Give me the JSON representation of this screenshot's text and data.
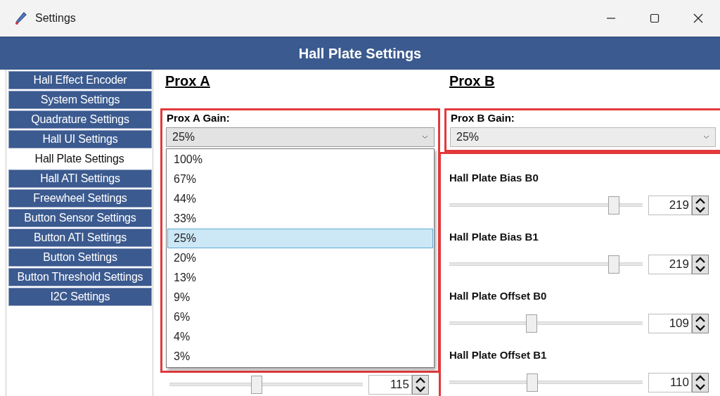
{
  "window": {
    "title": "Settings"
  },
  "header": {
    "title": "Hall Plate Settings"
  },
  "sidebar": {
    "items": [
      {
        "label": "Hall Effect Encoder",
        "selected": false
      },
      {
        "label": "System Settings",
        "selected": false
      },
      {
        "label": "Quadrature Settings",
        "selected": false
      },
      {
        "label": "Hall UI Settings",
        "selected": false
      },
      {
        "label": "Hall Plate Settings",
        "selected": true
      },
      {
        "label": "Hall ATI Settings",
        "selected": false
      },
      {
        "label": "Freewheel Settings",
        "selected": false
      },
      {
        "label": "Button Sensor Settings",
        "selected": false
      },
      {
        "label": "Button ATI Settings",
        "selected": false
      },
      {
        "label": "Button Settings",
        "selected": false
      },
      {
        "label": "Button Threshold Settings",
        "selected": false
      },
      {
        "label": "I2C Settings",
        "selected": false
      }
    ]
  },
  "prox_a": {
    "title": "Prox A",
    "gain": {
      "label": "Prox A Gain:",
      "value": "25%",
      "expanded": true,
      "highlighted": true,
      "options": [
        {
          "label": "100%",
          "selected": false
        },
        {
          "label": "67%",
          "selected": false
        },
        {
          "label": "44%",
          "selected": false
        },
        {
          "label": "33%",
          "selected": false
        },
        {
          "label": "25%",
          "selected": true
        },
        {
          "label": "20%",
          "selected": false
        },
        {
          "label": "13%",
          "selected": false
        },
        {
          "label": "9%",
          "selected": false
        },
        {
          "label": "6%",
          "selected": false
        },
        {
          "label": "4%",
          "selected": false
        },
        {
          "label": "3%",
          "selected": false
        }
      ]
    },
    "sliders": [
      {
        "level": 0.45,
        "value": "115"
      }
    ]
  },
  "prox_b": {
    "title": "Prox B",
    "gain": {
      "label": "Prox B Gain:",
      "value": "25%",
      "expanded": false,
      "highlighted": true
    },
    "sliders_highlighted": true,
    "sliders": [
      {
        "label": "Hall Plate Bias B0",
        "level": 0.85,
        "value": "219"
      },
      {
        "label": "Hall Plate Bias B1",
        "level": 0.85,
        "value": "219"
      },
      {
        "label": "Hall Plate Offset B0",
        "level": 0.425,
        "value": "109"
      },
      {
        "label": "Hall Plate Offset B1",
        "level": 0.43,
        "value": "110"
      }
    ]
  }
}
